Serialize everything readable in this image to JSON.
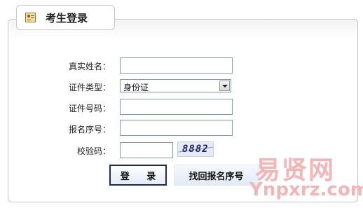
{
  "panel": {
    "title": "考生登录",
    "icon": "id-card-icon"
  },
  "form": {
    "name_label": "真实姓名：",
    "name_value": "",
    "id_type_label": "证件类型：",
    "id_type_selected": "身份证",
    "id_number_label": "证件号码：",
    "id_number_value": "",
    "registration_label": "报名序号：",
    "registration_value": "",
    "captcha_label": "校验码：",
    "captcha_value": "",
    "captcha_image_text": "8882"
  },
  "buttons": {
    "login": "登 录",
    "find_registration": "找回报名序号"
  },
  "watermark": {
    "cn": "易贤网",
    "en": "Ynpxrz.com"
  },
  "colors": {
    "input_border": "#7f9db9",
    "button_border": "#1c2a5a",
    "watermark": "#f3b5b5"
  }
}
